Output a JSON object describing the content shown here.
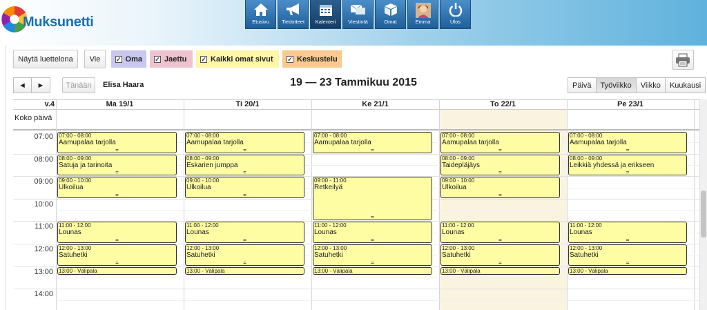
{
  "app": {
    "name": "Muksunetti"
  },
  "nav": [
    {
      "label": "Etusivu",
      "icon": "home-icon"
    },
    {
      "label": "Tiedotteet",
      "icon": "megaphone-icon"
    },
    {
      "label": "Kalenteri",
      "icon": "calendar-icon"
    },
    {
      "label": "Viestintä",
      "icon": "messages-icon"
    },
    {
      "label": "Omat",
      "icon": "box-icon"
    },
    {
      "label": "Emma",
      "icon": "profile-photo"
    },
    {
      "label": "Ulos",
      "icon": "power-icon"
    }
  ],
  "toolbar": {
    "list_label": "Näytä luettelona",
    "export_label": "Vie"
  },
  "filters": [
    {
      "label": "Oma",
      "color": "#c9c7ef",
      "checked": true
    },
    {
      "label": "Jaettu",
      "color": "#efc2cf",
      "checked": true
    },
    {
      "label": "Kaikki omat sivut",
      "color": "#fdf7a7",
      "checked": true
    },
    {
      "label": "Keskustelu",
      "color": "#f9c98f",
      "checked": true
    }
  ],
  "calnav": {
    "prev": "◄",
    "next": "►",
    "today": "Tänään",
    "person": "Elisa Haara",
    "range": "19 — 23 Tammikuu 2015"
  },
  "views": [
    "Päivä",
    "Työviikko",
    "Viikko",
    "Kuukausi"
  ],
  "active_view": "Työviikko",
  "calendar": {
    "week": "v.4",
    "allday": "Koko päivä",
    "highlight_color": "#faf3df",
    "days": [
      "Ma 19/1",
      "Ti 20/1",
      "Ke 21/1",
      "To 22/1",
      "Pe 23/1"
    ],
    "times": [
      "07:00",
      "08:00",
      "09:00",
      "10:00",
      "11:00",
      "12:00",
      "13:00",
      "14:00"
    ],
    "events": [
      [
        {
          "time": "07:00 - 08:00",
          "name": "Aamupalaa tarjolla"
        },
        {
          "time": "08:00 - 09:00",
          "name": "Satuja ja tarinoita"
        },
        {
          "time": "09:00 - 10:00",
          "name": "Ulkoilua"
        },
        {
          "time": "11:00 - 12:00",
          "name": "Lounas"
        },
        {
          "time": "12:00 - 13:00",
          "name": "Satuhetki"
        },
        {
          "time": "13:00 - Välipala",
          "name": ""
        }
      ],
      [
        {
          "time": "07:00 - 08:00",
          "name": "Aamupalaa tarjolla"
        },
        {
          "time": "08:00 - 09:00",
          "name": "Eskarien jumppa"
        },
        {
          "time": "09:00 - 10:00",
          "name": "Ulkoilua"
        },
        {
          "time": "11:00 - 12:00",
          "name": "Lounas"
        },
        {
          "time": "12:00 - 13:00",
          "name": "Satuhetki"
        },
        {
          "time": "13:00 - Välipala",
          "name": ""
        }
      ],
      [
        {
          "time": "07:00 - 08:00",
          "name": "Aamupalaa tarjolla"
        },
        {
          "time": "09:00 - 11:00",
          "name": "Retkeilyä"
        },
        {
          "time": "11:00 - 12:00",
          "name": "Lounas"
        },
        {
          "time": "12:00 - 13:00",
          "name": "Satuhetki"
        },
        {
          "time": "13:00 - Välipala",
          "name": ""
        }
      ],
      [
        {
          "time": "07:00 - 08:00",
          "name": "Aamupalaa tarjolla"
        },
        {
          "time": "08:00 - 09:00",
          "name": "Taidepläjäys"
        },
        {
          "time": "09:00 - 10:00",
          "name": "Ulkoilua"
        },
        {
          "time": "11:00 - 12:00",
          "name": "Lounas"
        },
        {
          "time": "12:00 - 13:00",
          "name": "Satuhetki"
        },
        {
          "time": "13:00 - Välipala",
          "name": ""
        }
      ],
      [
        {
          "time": "07:00 - 08:00",
          "name": "Aamupalaa tarjolla"
        },
        {
          "time": "08:00 - 09:00",
          "name": "Leikkiä yhdessä ja erikseen"
        },
        {
          "time": "11:00 - 12:00",
          "name": "Lounas"
        },
        {
          "time": "12:00 - 13:00",
          "name": "Satuhetki"
        },
        {
          "time": "13:00 - Välipala",
          "name": ""
        }
      ]
    ],
    "grip": "="
  }
}
